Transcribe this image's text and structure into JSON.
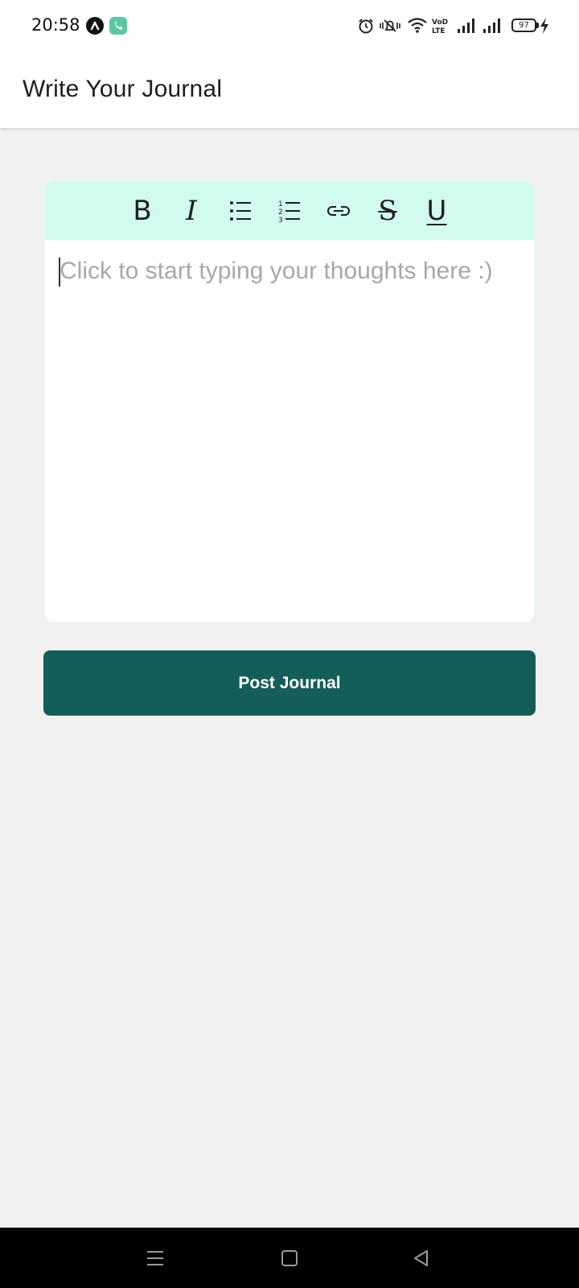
{
  "status_bar": {
    "time": "20:58",
    "battery": "97",
    "icons": [
      "app-notification-icon",
      "phone-notification-icon",
      "alarm-icon",
      "vibrate-icon",
      "wifi-icon",
      "volte-icon",
      "signal-icon",
      "signal-icon",
      "battery-icon",
      "charging-icon"
    ]
  },
  "app_bar": {
    "title": "Write Your Journal"
  },
  "editor": {
    "toolbar": [
      {
        "name": "bold",
        "label": "B"
      },
      {
        "name": "italic",
        "label": "I"
      },
      {
        "name": "bullet-list",
        "icon": "bullet-list-icon"
      },
      {
        "name": "numbered-list",
        "icon": "numbered-list-icon"
      },
      {
        "name": "link",
        "icon": "link-icon"
      },
      {
        "name": "strikethrough",
        "label": "S"
      },
      {
        "name": "underline",
        "label": "U"
      }
    ],
    "placeholder": "Click to start typing your thoughts here :)",
    "toolbar_color": "#d2fbef"
  },
  "post_button": {
    "label": "Post Journal",
    "color": "#145e59"
  },
  "nav_bar": {
    "buttons": [
      "menu-icon",
      "home-icon",
      "back-icon"
    ]
  }
}
